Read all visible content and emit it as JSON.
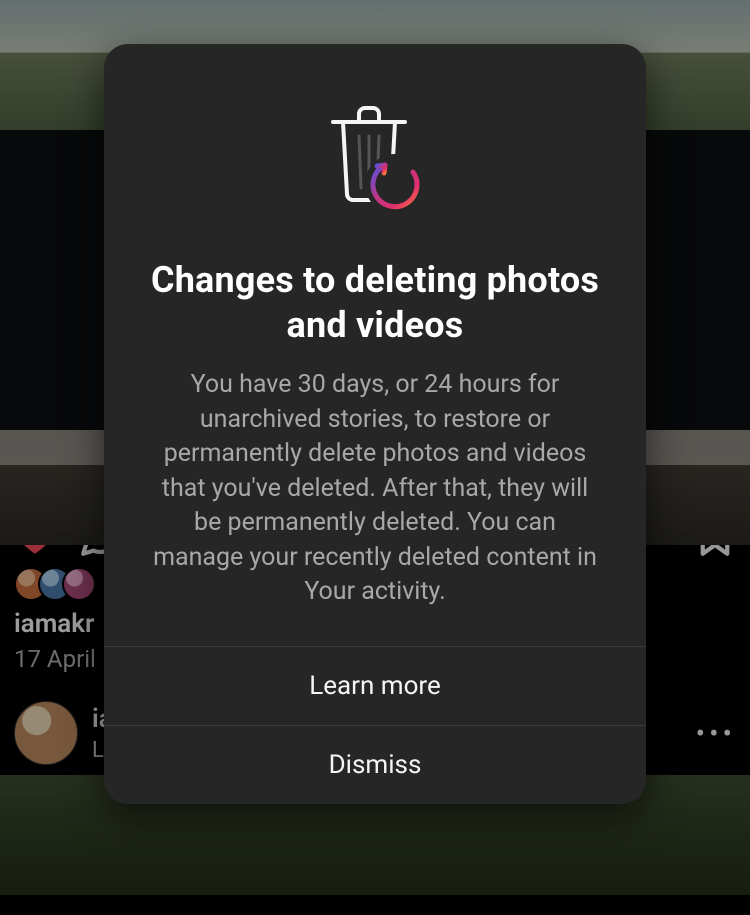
{
  "modal": {
    "title": "Changes to deleting photos and videos",
    "body": "You have 30 days, or 24 hours for unarchived stories, to restore or permanently delete photos and videos that you've deleted. After that, they will be permanently deleted. You can manage your recently deleted content in Your activity.",
    "learn_more": "Learn more",
    "dismiss": "Dismiss"
  },
  "feed": {
    "post": {
      "username": "iamakr",
      "date": "17 April"
    },
    "next_post": {
      "username": "ia",
      "location": "La"
    },
    "icons": {
      "like": "heart-filled-icon",
      "comment": "comment-icon",
      "bookmark": "bookmark-icon",
      "more": "more-icon"
    }
  },
  "colors": {
    "modal_bg": "#262626",
    "text_secondary": "#a8a8a8",
    "heart": "#ed4956",
    "gradient_start": "#5851DB",
    "gradient_mid": "#C13584",
    "gradient_end": "#F77737"
  }
}
